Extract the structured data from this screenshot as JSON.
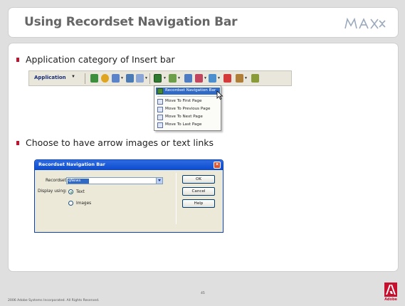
{
  "slide": {
    "title": "Using Recordset Navigation Bar",
    "logo_text": "MAX",
    "page_number": "45",
    "copyright": "2006 Adobe Systems Incorporated.  All Rights Reserved.",
    "adobe_label": "Adobe"
  },
  "bullets": [
    "Application category of Insert bar",
    "Choose to have arrow images or text links"
  ],
  "toolbar": {
    "category_label": "Application",
    "category_arrow": "▼"
  },
  "menu": {
    "items": [
      "Recordset Navigation Bar",
      "Move To First Page",
      "Move To Previous Page",
      "Move To Next Page",
      "Move To Last Page"
    ],
    "highlighted_index": 0
  },
  "dialog": {
    "title": "Recordset Navigation Bar",
    "close_glyph": "×",
    "recordset_label": "Recordset:",
    "recordset_value": "qNews",
    "display_label": "Display using:",
    "options": [
      "Text",
      "Images"
    ],
    "selected_option": "Text",
    "buttons": [
      "OK",
      "Cancel",
      "Help"
    ]
  },
  "colors": {
    "accent_red": "#c8102e",
    "highlight_blue": "#316ac5",
    "title_gray": "#666666"
  }
}
